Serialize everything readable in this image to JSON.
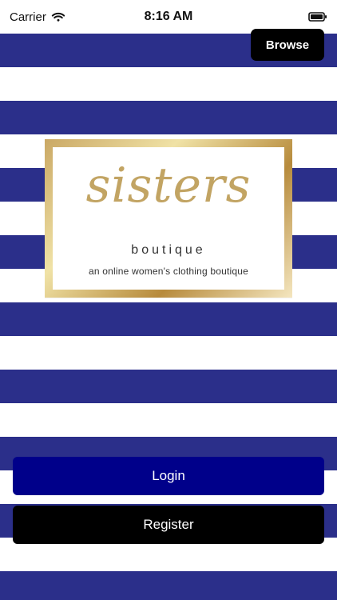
{
  "status_bar": {
    "carrier": "Carrier",
    "time": "8:16 AM",
    "icons": {
      "wifi": "wifi-icon",
      "battery": "battery-icon"
    }
  },
  "header": {
    "browse_label": "Browse"
  },
  "logo": {
    "script": "sisters",
    "subtitle": "boutique",
    "tagline": "an online women's clothing boutique"
  },
  "actions": {
    "login_label": "Login",
    "register_label": "Register"
  },
  "colors": {
    "stripe_blue": "#2b2f8a",
    "button_blue": "#00008a",
    "button_black": "#000000",
    "gold": "#c2a463"
  }
}
